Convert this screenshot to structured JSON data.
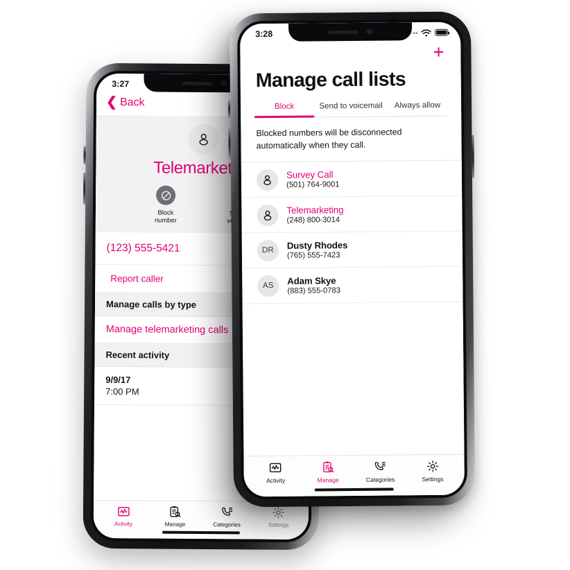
{
  "front_phone": {
    "status_bar": {
      "time": "3:28",
      "wifi_icon": "wifi-icon",
      "battery_icon": "battery-icon",
      "signal_icon": "signal-dots-icon"
    },
    "add_button": {
      "icon": "plus-icon",
      "label": "+"
    },
    "title": "Manage call lists",
    "tabs": [
      {
        "label": "Block",
        "active": true
      },
      {
        "label": "Send to voicemail",
        "active": false
      },
      {
        "label": "Always allow",
        "active": false
      }
    ],
    "note": "Blocked numbers will be disconnected automatically when they call.",
    "contacts": [
      {
        "name": "Survey Call",
        "phone": "(501) 764-9001",
        "avatar_type": "person-icon",
        "initials": "",
        "pink": true
      },
      {
        "name": "Telemarketing",
        "phone": "(248) 800-3014",
        "avatar_type": "person-icon",
        "initials": "",
        "pink": true
      },
      {
        "name": "Dusty Rhodes",
        "phone": "(765) 555-7423",
        "avatar_type": "initials",
        "initials": "DR",
        "pink": false
      },
      {
        "name": "Adam Skye",
        "phone": "(883) 555-0783",
        "avatar_type": "initials",
        "initials": "AS",
        "pink": false
      }
    ],
    "tab_bar": [
      {
        "label": "Activity",
        "icon": "activity-chart-icon",
        "active": false
      },
      {
        "label": "Manage",
        "icon": "clipboard-search-icon",
        "active": true
      },
      {
        "label": "Categories",
        "icon": "phone-list-icon",
        "active": false
      },
      {
        "label": "Settings",
        "icon": "gear-icon",
        "active": false
      }
    ]
  },
  "back_phone": {
    "status_bar": {
      "time": "3:27"
    },
    "back_button": {
      "label": "Back",
      "icon": "chevron-left-icon"
    },
    "contact": {
      "name": "Telemarketing",
      "avatar_icon": "person-icon",
      "actions": [
        {
          "label_line1": "Block",
          "label_line2": "number",
          "icon": "block-circle-icon"
        },
        {
          "label_line1": "Send to",
          "label_line2": "voicemail",
          "icon": "voicemail-icon"
        }
      ]
    },
    "phone_number": "(123) 555-5421",
    "report_caller": "Report caller",
    "manage_header": "Manage calls by type",
    "manage_action": "Manage telemarketing calls",
    "recent_header": "Recent activity",
    "recent_entry": {
      "date": "9/9/17",
      "time": "7:00 PM"
    },
    "tab_bar": [
      {
        "label": "Activity",
        "icon": "activity-chart-icon",
        "active": true
      },
      {
        "label": "Manage",
        "icon": "clipboard-search-icon",
        "active": false
      },
      {
        "label": "Categories",
        "icon": "phone-list-icon",
        "active": false
      },
      {
        "label": "Settings",
        "icon": "gear-icon",
        "active": false
      }
    ]
  },
  "theme": {
    "accent": "#E20074",
    "text": "#111111",
    "avatar_bg": "#E6E6E6",
    "hero_bg": "#F2F2F4"
  }
}
